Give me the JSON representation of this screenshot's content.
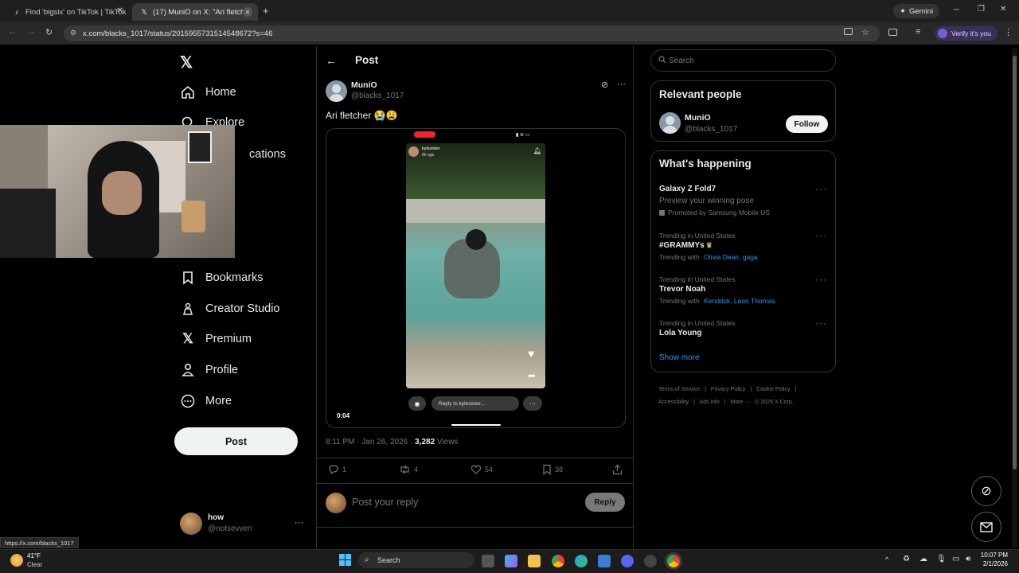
{
  "browser": {
    "tabs": [
      {
        "title": "Find 'bigsix' on TikTok | TikTok",
        "icon": "tiktok-icon"
      },
      {
        "title": "(17) MuniO on X: \"Ari fletcher",
        "icon": "x-logo-icon"
      }
    ],
    "new_tab": "+",
    "gemini_label": "Gemini",
    "url": "x.com/blacks_1017/status/2015955731514548672?s=46",
    "profile_label": "Verify it's you",
    "status_url": "https://x.com/blacks_1017"
  },
  "nav": {
    "items": [
      {
        "label": "Home",
        "icon": "home-icon"
      },
      {
        "label": "Explore",
        "icon": "search-icon"
      },
      {
        "label": "Notifications",
        "visible_label": "cations",
        "icon": "bell-icon"
      },
      {
        "label": "Bookmarks",
        "icon": "bookmark-icon"
      },
      {
        "label": "Creator Studio",
        "icon": "creator-icon"
      },
      {
        "label": "Premium",
        "icon": "x-logo-icon"
      },
      {
        "label": "Profile",
        "icon": "person-icon"
      },
      {
        "label": "More",
        "icon": "more-circle-icon"
      }
    ],
    "post_button": "Post",
    "account": {
      "name": "how",
      "handle": "@notsevven",
      "more": "···"
    }
  },
  "post": {
    "header_title": "Post",
    "author_name": "MuniO",
    "author_handle": "@blacks_1017",
    "text": "Ari fletcher 😭😩",
    "video": {
      "inner_user": "kylesister",
      "inner_time": "8h ago",
      "reply_placeholder": "Reply to kylesister...",
      "time": "0:04"
    },
    "timestamp": "8:11 PM · Jan 26, 2026 ·",
    "views_count": "3,282",
    "views_label": "Views",
    "actions": {
      "replies": "1",
      "reposts": "4",
      "likes": "54",
      "bookmarks": "38"
    },
    "reply_placeholder": "Post your reply",
    "reply_button": "Reply"
  },
  "right": {
    "search_placeholder": "Search",
    "relevant": {
      "title": "Relevant people",
      "name": "MuniO",
      "handle": "@blacks_1017",
      "follow": "Follow"
    },
    "happening": {
      "title": "What's happening",
      "items": [
        {
          "top": "Galaxy Z Fold7",
          "sub": "Preview your winning pose",
          "promo": "Promoted by Samsung Mobile US"
        },
        {
          "context": "Trending in United States",
          "top": "#GRAMMYs",
          "with_label": "Trending with",
          "with": "Olivia Dean, gaga"
        },
        {
          "context": "Trending in United States",
          "top": "Trevor Noah",
          "with_label": "Trending with",
          "with": "Kendrick, Leon Thomas"
        },
        {
          "context": "Trending in United States",
          "top": "Lola Young"
        }
      ],
      "show_more": "Show more"
    },
    "footer": [
      "Terms of Service",
      "|",
      "Privacy Policy",
      "|",
      "Cookie Policy",
      "|",
      "Accessibility",
      "|",
      "Ads info",
      "|",
      "More ···",
      "© 2026 X Corp."
    ]
  },
  "taskbar": {
    "weather_temp": "41°F",
    "weather_desc": "Clear",
    "search_label": "Search",
    "time": "10:07 PM",
    "date": "2/1/2026"
  },
  "colors": {
    "accent": "#1d9bf0",
    "bg": "#000000",
    "border": "#2f3336",
    "muted": "#71767b"
  }
}
